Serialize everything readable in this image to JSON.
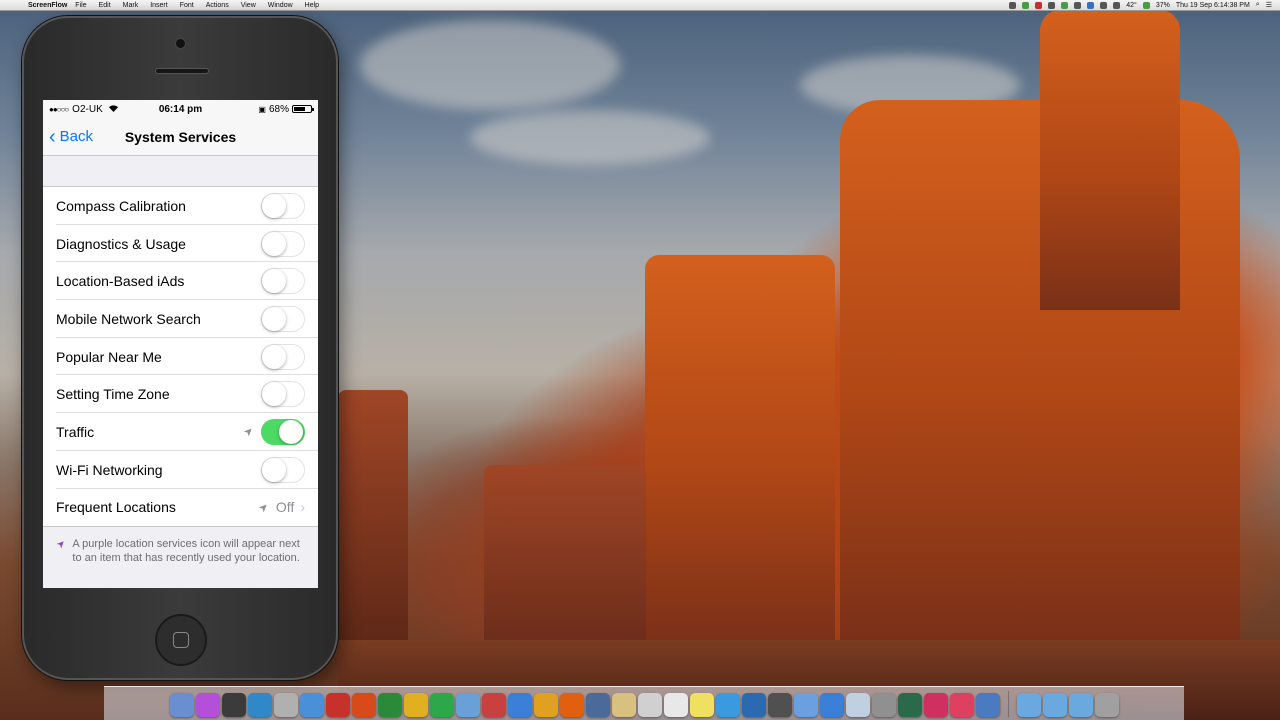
{
  "menubar": {
    "app": "ScreenFlow",
    "menus": [
      "File",
      "Edit",
      "Mark",
      "Insert",
      "Font",
      "Actions",
      "View",
      "Window",
      "Help"
    ],
    "battery_pct": "37%",
    "datetime": "Thu 19 Sep  6:14:38 PM",
    "temperature": "42°"
  },
  "phone": {
    "status": {
      "signal": "●●○○○",
      "carrier": "O2-UK",
      "time": "06:14 pm",
      "battery": "68%",
      "battery_level": 0.68
    },
    "nav": {
      "back_label": "Back",
      "title": "System Services"
    },
    "rows": [
      {
        "label": "Compass Calibration",
        "on": false
      },
      {
        "label": "Diagnostics & Usage",
        "on": false
      },
      {
        "label": "Location-Based iAds",
        "on": false
      },
      {
        "label": "Mobile Network Search",
        "on": false
      },
      {
        "label": "Popular Near Me",
        "on": false
      },
      {
        "label": "Setting Time Zone",
        "on": false
      },
      {
        "label": "Traffic",
        "on": true
      },
      {
        "label": "Wi-Fi Networking",
        "on": false
      }
    ],
    "frequent": {
      "label": "Frequent Locations",
      "value": "Off"
    },
    "footer_note": "A purple location services icon will appear next to an item that has recently used your location.",
    "colors": {
      "tint": "#007aff",
      "toggle_on": "#4cd964",
      "location_purple": "#8e44c4"
    }
  },
  "dock": {
    "icon_colors": [
      "#6a8fd0",
      "#b34fd8",
      "#3b3b3b",
      "#2f88c8",
      "#b0b0b0",
      "#4a90d8",
      "#c8302a",
      "#d84a1a",
      "#2a8a3a",
      "#e0b020",
      "#2ca84a",
      "#6aa0d8",
      "#c84040",
      "#3a7fd8",
      "#e0a020",
      "#e06010",
      "#4a6a9a",
      "#d8c080",
      "#d0d0d0",
      "#e8e8e8",
      "#f0e060",
      "#3a9ae0",
      "#2a6ab0",
      "#505050",
      "#6aa0e0",
      "#3a7fd8",
      "#c0d0e0",
      "#909090",
      "#2a6a4a",
      "#d03060",
      "#e04060",
      "#4a7ac0",
      "#6aa8e0",
      "#6aa8e0",
      "#6aa8e0",
      "#a0a0a0"
    ]
  }
}
